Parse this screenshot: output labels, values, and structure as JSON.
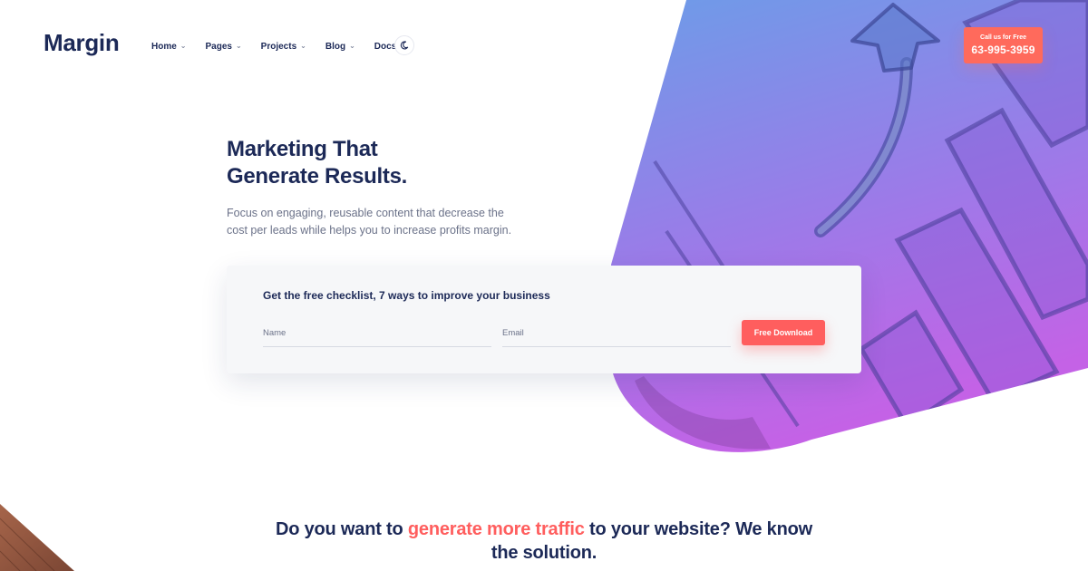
{
  "header": {
    "logo": "Margin",
    "nav": [
      {
        "label": "Home",
        "has_dropdown": true
      },
      {
        "label": "Pages",
        "has_dropdown": true
      },
      {
        "label": "Projects",
        "has_dropdown": true
      },
      {
        "label": "Blog",
        "has_dropdown": true
      },
      {
        "label": "Docs",
        "has_dropdown": false
      }
    ],
    "theme_toggle_icon": "moon-icon",
    "call_cta": {
      "small": "Call us for Free",
      "number": "63-995-3959"
    },
    "chevron_glyph": "⌄"
  },
  "hero": {
    "title_line1": "Marketing That",
    "title_line2": "Generate Results.",
    "subtitle": "Focus on engaging, reusable content that decrease the cost per leads while helps you to increase profits margin.",
    "art_icons": [
      "growth-arrow-icon",
      "bar-chart-icon"
    ]
  },
  "form": {
    "title": "Get the free checklist, 7 ways to improve your business",
    "name_placeholder": "Name",
    "email_placeholder": "Email",
    "submit_label": "Free Download"
  },
  "section": {
    "heading_part1": "Do you want to ",
    "heading_accent": "generate more traffic",
    "heading_part2": " to your website? We know the solution."
  },
  "colors": {
    "brand_navy": "#1c2957",
    "accent_red": "#ff5e5e",
    "accent_orange": "#ff6a5c",
    "gradient_top": "#6d9ce8",
    "gradient_bottom": "#c462e6"
  }
}
